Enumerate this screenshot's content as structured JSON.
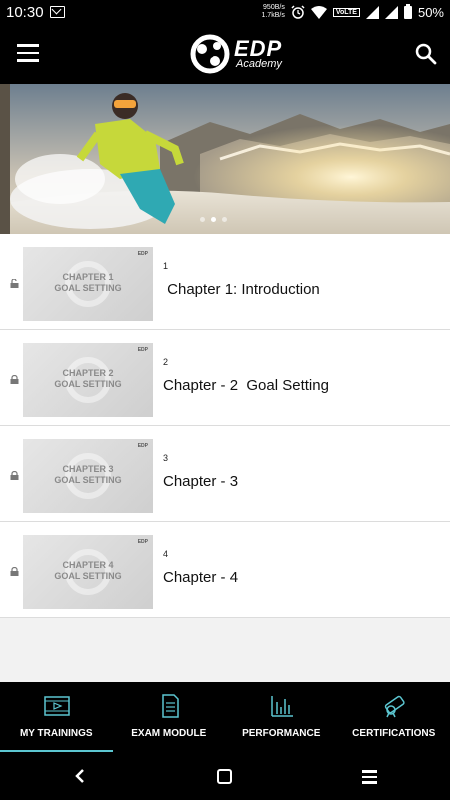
{
  "status_bar": {
    "time": "10:30",
    "net_speed_up": "950B/s",
    "net_speed_down": "1.7kB/s",
    "volte": "VoLTE",
    "battery": "50%"
  },
  "header": {
    "logo_title": "EDP",
    "logo_subtitle": "Academy"
  },
  "banner": {
    "slide_count": 3,
    "active_slide": 1
  },
  "chapters": [
    {
      "number": "1",
      "title": " Chapter 1: Introduction",
      "thumb_line1": "CHAPTER 1",
      "thumb_line2": "GOAL SETTING",
      "locked": false
    },
    {
      "number": "2",
      "title": "Chapter - 2  Goal Setting",
      "thumb_line1": "CHAPTER 2",
      "thumb_line2": "GOAL SETTING",
      "locked": true
    },
    {
      "number": "3",
      "title": "Chapter - 3",
      "thumb_line1": "CHAPTER 3",
      "thumb_line2": "GOAL SETTING",
      "locked": true
    },
    {
      "number": "4",
      "title": "Chapter - 4",
      "thumb_line1": "CHAPTER 4",
      "thumb_line2": "GOAL SETTING",
      "locked": true
    }
  ],
  "bottom_nav": [
    {
      "label": "MY TRAININGS",
      "icon": "video-icon",
      "active": true
    },
    {
      "label": "EXAM MODULE",
      "icon": "document-icon",
      "active": false
    },
    {
      "label": "PERFORMANCE",
      "icon": "bar-chart-icon",
      "active": false
    },
    {
      "label": "CERTIFICATIONS",
      "icon": "certificate-icon",
      "active": false
    }
  ],
  "colors": {
    "accent": "#5cc6d1",
    "header_bg": "#000000",
    "list_bg": "#f2f2f2"
  }
}
